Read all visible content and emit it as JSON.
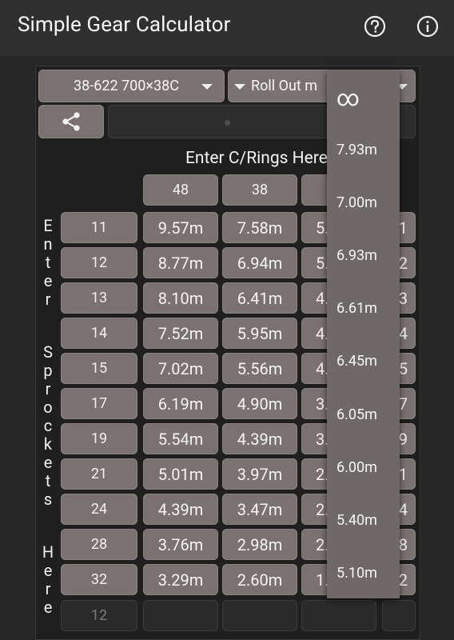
{
  "app": {
    "title": "Simple Gear Calculator"
  },
  "toolbar": {
    "help_icon": "help-circle-icon",
    "info_icon": "info-circle-icon"
  },
  "controls": {
    "tyre_select": "38-622 700×38C",
    "mode_select": "Roll Out m",
    "share_icon": "share-icon"
  },
  "table": {
    "header_label": "Enter C/Rings Here",
    "side_label": "Enter Sprockets Here",
    "chainrings": [
      "48",
      "38"
    ],
    "sprockets": [
      "11",
      "12",
      "13",
      "14",
      "15",
      "17",
      "19",
      "21",
      "24",
      "28",
      "32"
    ],
    "new_sprocket_placeholder": "12",
    "rows": [
      [
        "9.57m",
        "7.58m",
        "5.",
        "1"
      ],
      [
        "8.77m",
        "6.94m",
        "5.",
        "2"
      ],
      [
        "8.10m",
        "6.41m",
        "4.",
        "3"
      ],
      [
        "7.52m",
        "5.95m",
        "4.",
        "4"
      ],
      [
        "7.02m",
        "5.56m",
        "4.",
        "5"
      ],
      [
        "6.19m",
        "4.90m",
        "3.",
        "7"
      ],
      [
        "5.54m",
        "4.39m",
        "3.",
        "9"
      ],
      [
        "5.01m",
        "3.97m",
        "2.",
        "1"
      ],
      [
        "4.39m",
        "3.47m",
        "2.",
        "4"
      ],
      [
        "3.76m",
        "2.98m",
        "2.",
        "8"
      ],
      [
        "3.29m",
        "2.60m",
        "1.",
        "2"
      ]
    ]
  },
  "dropdown": {
    "items": [
      "∞",
      "7.93m",
      "7.00m",
      "6.93m",
      "6.61m",
      "6.45m",
      "6.05m",
      "6.00m",
      "5.40m",
      "5.10m"
    ]
  }
}
